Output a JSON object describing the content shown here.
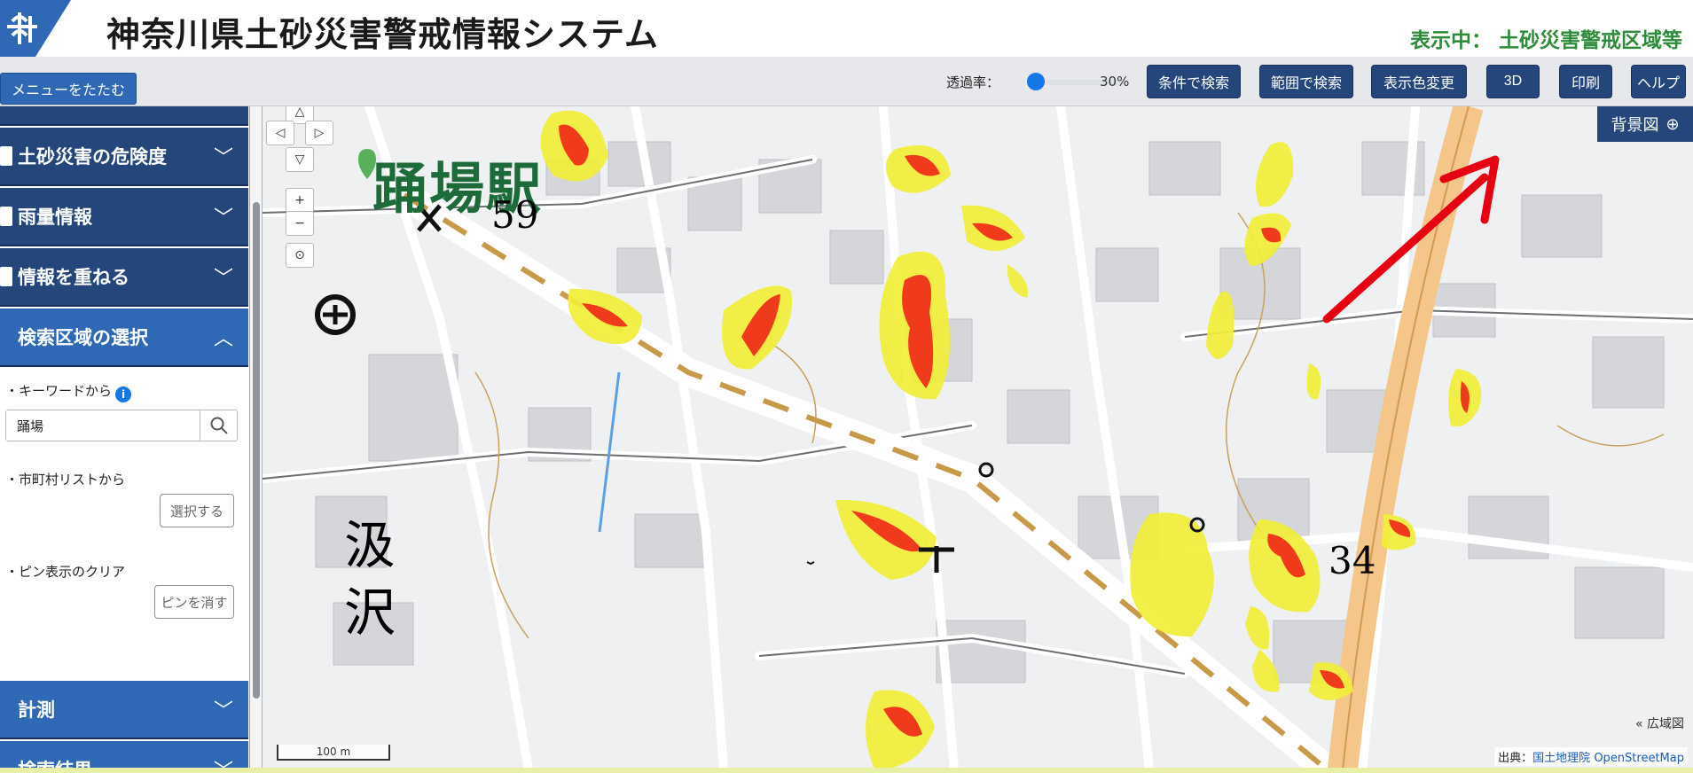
{
  "header": {
    "title": "神奈川県土砂災害警戒情報システム",
    "status_prefix": "表示中：",
    "status_value": "土砂災害警戒区域等"
  },
  "toolbar": {
    "collapse_menu": "メニューをたたむ",
    "opacity_label": "透過率：",
    "opacity_value": "30%",
    "opacity_fraction": 0.3,
    "buttons": {
      "search_condition": "条件で検索",
      "search_range": "範囲で検索",
      "color_change": "表示色変更",
      "view_3d": "3D",
      "print": "印刷",
      "help": "ヘルプ"
    }
  },
  "sidebar": {
    "sections": {
      "danger": "土砂災害の危険度",
      "rainfall": "雨量情報",
      "overlay": "情報を重ねる",
      "search_area": "検索区域の選択",
      "measure": "計測",
      "results": "検索結果"
    },
    "keyword_label": "・キーワードから",
    "keyword_value": "踊場",
    "city_list_label": "・市町村リストから",
    "select_button": "選択する",
    "pin_clear_label": "・ピン表示のクリア",
    "pin_clear_button": "ピンを消す"
  },
  "map": {
    "station": "踊場駅",
    "elevation_1": "59",
    "elevation_2": "34",
    "place_name_1": "汲",
    "place_name_2": "沢",
    "background_button": "背景図",
    "wide_map": "« 広域図",
    "scale": "100 m",
    "attribution_prefix": "出典：",
    "attribution_gsi": "国土地理院",
    "attribution_osm": "OpenStreetMap"
  },
  "colors": {
    "header_navy": "#24467a",
    "active_blue": "#2f69b5",
    "status_green": "#2e8b3a",
    "warning_yellow": "#f2ee3a",
    "danger_red": "#f03a1c",
    "annotation_arrow": "#e60012"
  }
}
